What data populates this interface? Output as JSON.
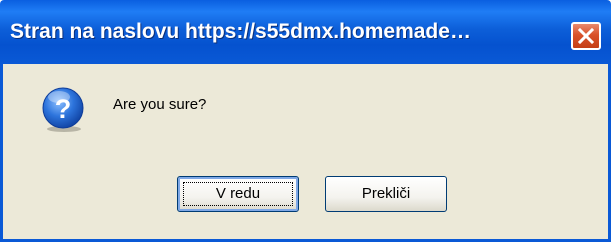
{
  "dialog": {
    "title": "Stran na naslovu https://s55dmx.homemade…",
    "close_icon": "close-icon",
    "message": "Are you sure?",
    "icon": "question-icon",
    "buttons": {
      "ok_label": "V redu",
      "cancel_label": "Prekliči"
    },
    "colors": {
      "titlebar": "#0a59d6",
      "body_background": "#ece9d8",
      "close_button": "#d9522a",
      "icon_blue": "#1c5fc9"
    }
  }
}
